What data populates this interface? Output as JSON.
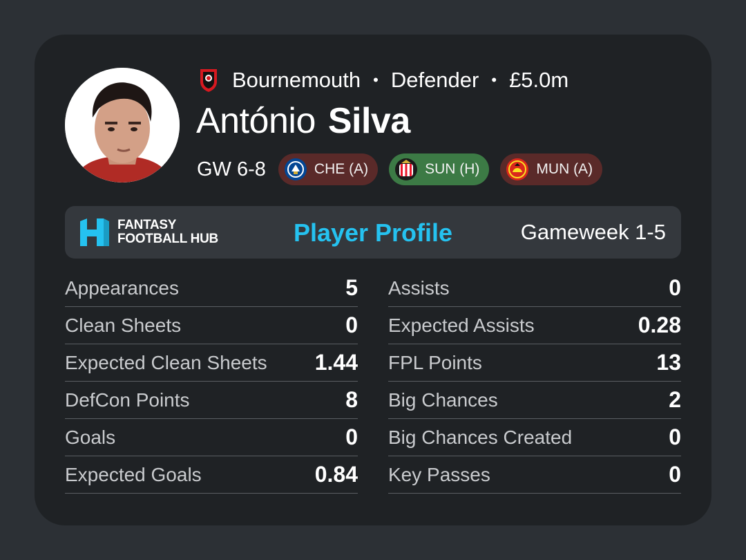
{
  "player": {
    "first_name": "António",
    "last_name": "Silva",
    "club": "Bournemouth",
    "position": "Defender",
    "price": "£5.0m",
    "separator": "•",
    "avatar_icon": "player-portrait-icon",
    "club_crest_icon": "bournemouth-crest-icon"
  },
  "fixtures": {
    "label": "GW 6-8",
    "items": [
      {
        "label": "CHE (A)",
        "venue": "away",
        "icon": "chelsea-crest-icon",
        "color": "#5a2a29"
      },
      {
        "label": "SUN (H)",
        "venue": "home",
        "icon": "sunderland-crest-icon",
        "color": "#3c7a45"
      },
      {
        "label": "MUN (A)",
        "venue": "away",
        "icon": "man-utd-crest-icon",
        "color": "#5a2a29"
      }
    ]
  },
  "banner": {
    "logo_line1": "FANTASY",
    "logo_line2": "FOOTBALL HUB",
    "title": "Player Profile",
    "gameweek": "Gameweek 1-5",
    "accent_color": "#25c2f0"
  },
  "stats": {
    "left": [
      {
        "label": "Appearances",
        "value": "5"
      },
      {
        "label": "Clean Sheets",
        "value": "0"
      },
      {
        "label": "Expected Clean Sheets",
        "value": "1.44"
      },
      {
        "label": "DefCon Points",
        "value": "8"
      },
      {
        "label": "Goals",
        "value": "0"
      },
      {
        "label": "Expected Goals",
        "value": "0.84"
      }
    ],
    "right": [
      {
        "label": "Assists",
        "value": "0"
      },
      {
        "label": "Expected Assists",
        "value": "0.28"
      },
      {
        "label": "FPL Points",
        "value": "13"
      },
      {
        "label": "Big Chances",
        "value": "2"
      },
      {
        "label": "Big Chances Created",
        "value": "0"
      },
      {
        "label": "Key Passes",
        "value": "0"
      }
    ]
  }
}
